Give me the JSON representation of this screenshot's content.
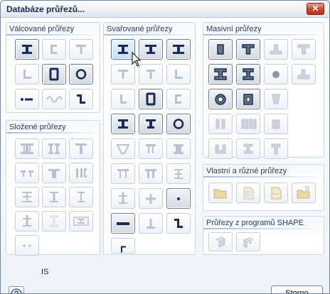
{
  "window": {
    "title": "Databáze průřezů...",
    "close_glyph": "✕"
  },
  "groups": {
    "rolled": "Válcované průřezy",
    "composite": "Složené průřezy",
    "welded": "Svařované průřezy",
    "solid": "Masivní průřezy",
    "custom": "Vlastní a různé průřezy",
    "shape": "Průřezy z programů SHAPE"
  },
  "status_text": "IS",
  "footer": {
    "cancel_label": "Storno"
  },
  "colors": {
    "active_icon": "#1c2a55",
    "inactive_icon": "#b9c3d0",
    "selected_border": "#4477c4",
    "accent": "#8da9d0"
  }
}
